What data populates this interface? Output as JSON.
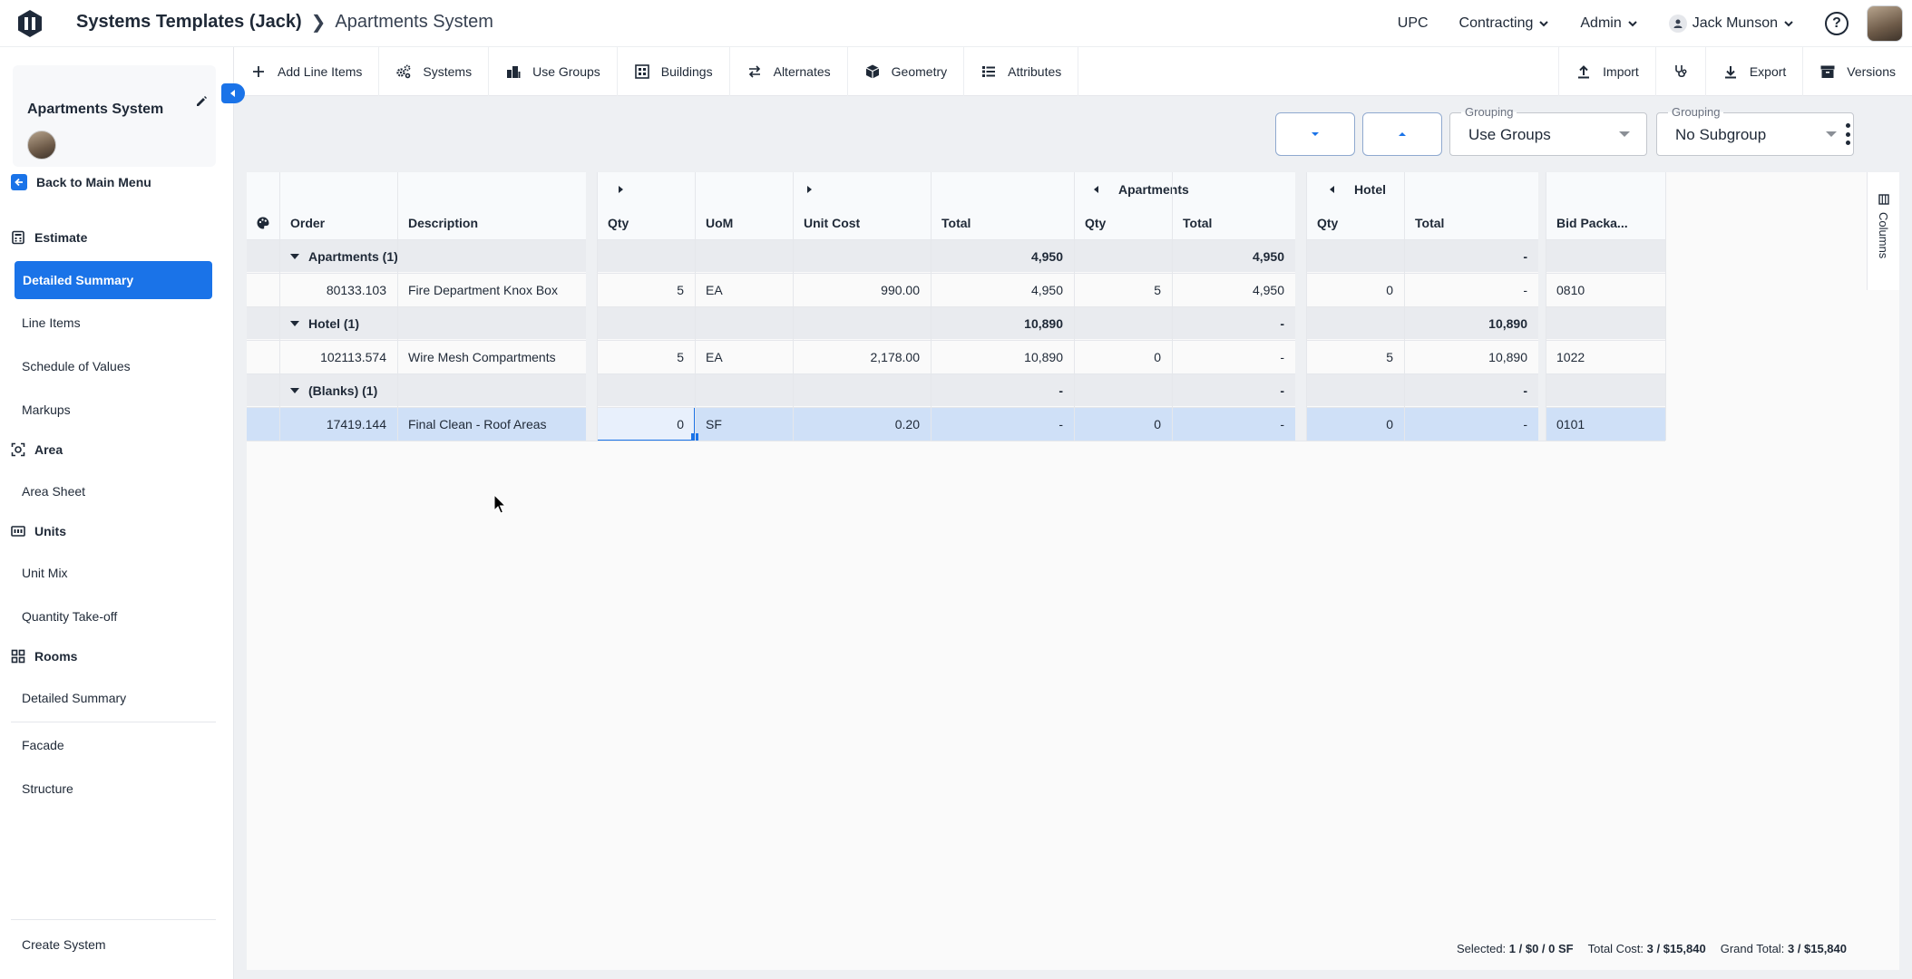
{
  "breadcrumb": {
    "parent": "Systems Templates (Jack)",
    "current": "Apartments System"
  },
  "topnav": {
    "upc": "UPC",
    "contracting": "Contracting",
    "admin": "Admin",
    "user": "Jack Munson",
    "help": "?"
  },
  "sidebar": {
    "system_name": "Apartments System",
    "back": "Back to Main Menu",
    "sections": [
      {
        "label": "Estimate",
        "icon": "calculator-icon"
      },
      {
        "label": "Area",
        "icon": "area-icon"
      },
      {
        "label": "Units",
        "icon": "units-icon"
      },
      {
        "label": "Rooms",
        "icon": "rooms-icon"
      }
    ],
    "estimate_items": [
      "Detailed Summary",
      "Line Items",
      "Schedule of Values",
      "Markups"
    ],
    "area_items": [
      "Area Sheet"
    ],
    "units_items": [
      "Unit Mix",
      "Quantity Take-off"
    ],
    "rooms_items": [
      "Detailed Summary"
    ],
    "other_items": [
      "Facade",
      "Structure"
    ],
    "footer": "Create System"
  },
  "toolbar": {
    "items": [
      "Add Line Items",
      "Systems",
      "Use Groups",
      "Buildings",
      "Alternates",
      "Geometry",
      "Attributes"
    ],
    "right": [
      "Import",
      "Export",
      "Versions"
    ]
  },
  "controls": {
    "grouping1": {
      "label": "Grouping",
      "value": "Use Groups"
    },
    "grouping2": {
      "label": "Grouping",
      "value": "No Subgroup"
    }
  },
  "grid": {
    "group_headers": {
      "apartments": "Apartments",
      "hotel": "Hotel"
    },
    "columns": [
      "Order",
      "Description",
      "Qty",
      "UoM",
      "Unit Cost",
      "Total",
      "Qty",
      "Total",
      "Qty",
      "Total",
      "Bid Packa..."
    ],
    "columns_tab": "Columns",
    "groups": [
      {
        "label": "Apartments (1)",
        "total": "4,950",
        "apt_total": "4,950",
        "hotel_total": "-",
        "row": {
          "order": "80133.103",
          "desc": "Fire Department Knox Box",
          "qty": "5",
          "uom": "EA",
          "unit_cost": "990.00",
          "total": "4,950",
          "apt_qty": "5",
          "apt_total": "4,950",
          "hotel_qty": "0",
          "hotel_total": "-",
          "bid": "0810"
        }
      },
      {
        "label": "Hotel (1)",
        "total": "10,890",
        "apt_total": "-",
        "hotel_total": "10,890",
        "row": {
          "order": "102113.574",
          "desc": "Wire Mesh Compartments",
          "qty": "5",
          "uom": "EA",
          "unit_cost": "2,178.00",
          "total": "10,890",
          "apt_qty": "0",
          "apt_total": "-",
          "hotel_qty": "5",
          "hotel_total": "10,890",
          "bid": "1022"
        }
      },
      {
        "label": "(Blanks) (1)",
        "total": "-",
        "apt_total": "-",
        "hotel_total": "-",
        "row": {
          "order": "17419.144",
          "desc": "Final Clean - Roof Areas",
          "qty": "0",
          "uom": "SF",
          "unit_cost": "0.20",
          "total": "-",
          "apt_qty": "0",
          "apt_total": "-",
          "hotel_qty": "0",
          "hotel_total": "-",
          "bid": "0101"
        }
      }
    ]
  },
  "status": {
    "selected_label": "Selected:",
    "selected_value": "1 / $0 / 0 SF",
    "total_label": "Total Cost:",
    "total_value": "3 / $15,840",
    "grand_label": "Grand Total:",
    "grand_value": "3 / $15,840"
  },
  "colors": {
    "accent": "#1a73e8",
    "selected_row": "#cfe0f7",
    "group_row": "#e9ebef"
  }
}
